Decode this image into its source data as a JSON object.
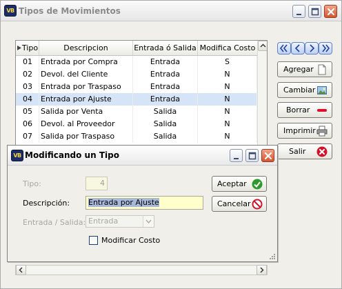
{
  "main_window": {
    "title": "Tipos de Movimientos",
    "icon": "app-logo-icon",
    "icon_text": "VB",
    "controls": [
      "minimize-icon",
      "maximize-icon",
      "close-icon"
    ]
  },
  "grid": {
    "columns": [
      "Tipo",
      "Descripcion",
      "Entrada ó Salida",
      "Modifica Costo"
    ],
    "rows": [
      {
        "tipo": "01",
        "descripcion": "Entrada por Compra",
        "entrada_salida": "Entrada",
        "modifica": "S"
      },
      {
        "tipo": "02",
        "descripcion": "Devol. del Cliente",
        "entrada_salida": "Entrada",
        "modifica": "N"
      },
      {
        "tipo": "03",
        "descripcion": "Entrada por Traspaso",
        "entrada_salida": "Entrada",
        "modifica": "N"
      },
      {
        "tipo": "04",
        "descripcion": "Entrada por Ajuste",
        "entrada_salida": "Entrada",
        "modifica": "N"
      },
      {
        "tipo": "05",
        "descripcion": "Salida por Venta",
        "entrada_salida": "Salida",
        "modifica": "N"
      },
      {
        "tipo": "06",
        "descripcion": "Devol. al Proveedor",
        "entrada_salida": "Salida",
        "modifica": "N"
      },
      {
        "tipo": "07",
        "descripcion": "Salida por Traspaso",
        "entrada_salida": "Salida",
        "modifica": "N"
      }
    ],
    "selected_row_index": 3
  },
  "navigation": [
    "first-record-icon",
    "previous-record-icon",
    "next-record-icon",
    "last-record-icon"
  ],
  "actions": {
    "agregar": {
      "label": "Agregar",
      "icon": "new-document-icon"
    },
    "cambiar": {
      "label": "Cambiar",
      "icon": "edit-picture-icon"
    },
    "borrar": {
      "label": "Borrar",
      "icon": "delete-bar-icon"
    },
    "imprimir": {
      "label": "Imprimir",
      "icon": "printer-icon"
    },
    "salir": {
      "label": "Salir",
      "icon": "exit-x-icon"
    }
  },
  "dialog": {
    "title": "Modificando un Tipo",
    "tipo_label": "Tipo:",
    "tipo_value": "4",
    "descripcion_label": "Descripción:",
    "descripcion_value": "Entrada por Ajuste",
    "entrada_salida_label": "Entrada / Salida:",
    "entrada_salida_value": "Entrada",
    "modificar_costo_label": "Modificar Costo",
    "modificar_costo_checked": false,
    "aceptar": {
      "label": "Aceptar",
      "icon": "check-icon"
    },
    "cancelar": {
      "label": "Cancelar",
      "icon": "cancel-icon"
    }
  },
  "colors": {
    "selected_row": "#d6e4f7",
    "input_background": "#ffffcc",
    "close_button": "#d4542f",
    "nav_button": "#bcd0f5"
  }
}
